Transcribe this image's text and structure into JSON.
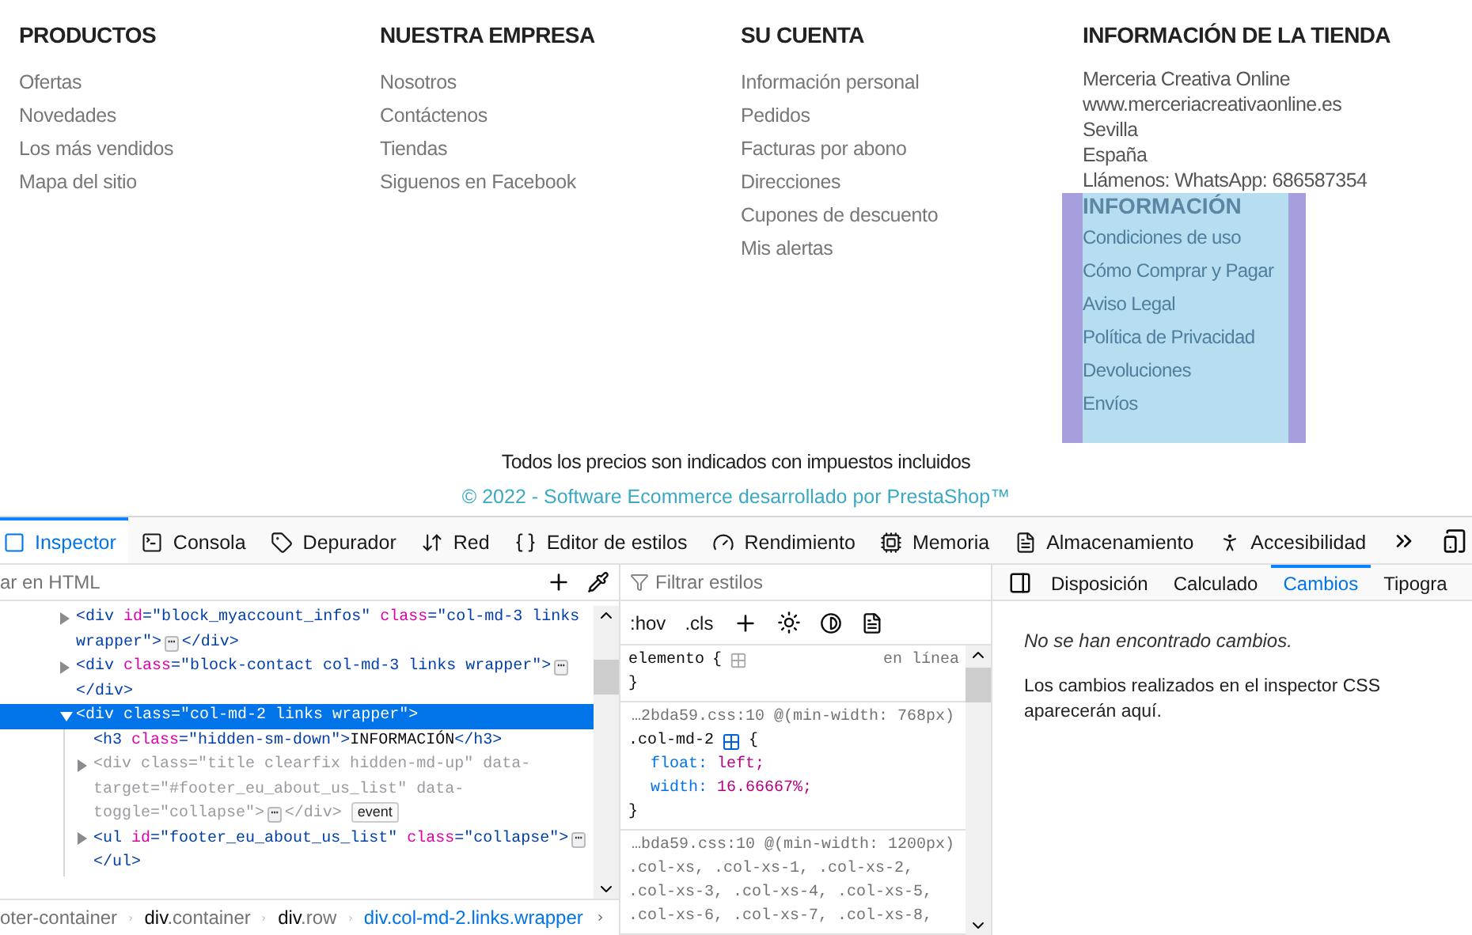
{
  "footer": {
    "columns": [
      {
        "title": "PRODUCTOS",
        "links": [
          "Ofertas",
          "Novedades",
          "Los más vendidos",
          "Mapa del sitio"
        ]
      },
      {
        "title": "NUESTRA EMPRESA",
        "links": [
          "Nosotros",
          "Contáctenos",
          "Tiendas",
          "Siguenos en Facebook"
        ]
      },
      {
        "title": "SU CUENTA",
        "links": [
          "Información personal",
          "Pedidos",
          "Facturas por abono",
          "Direcciones",
          "Cupones de descuento",
          "Mis alertas"
        ]
      }
    ],
    "store_info": {
      "title": "INFORMACIÓN DE LA TIENDA",
      "lines": [
        "Merceria Creativa Online",
        "www.merceriacreativaonline.es",
        "Sevilla",
        "España",
        "Llámenos: WhatsApp: 686587354"
      ]
    },
    "info_block": {
      "title": "INFORMACIÓN",
      "highlighted": true,
      "links": [
        "Condiciones de uso",
        "Cómo Comprar y Pagar",
        "Aviso Legal",
        "Política de Privacidad",
        "Devoluciones",
        "Envíos"
      ]
    },
    "tax_note": "Todos los precios son indicados con impuestos incluidos",
    "copyright": "© 2022 - Software Ecommerce desarrollado por PrestaShop™"
  },
  "devtools": {
    "tabs": [
      {
        "label": "Inspector",
        "selected": true
      },
      {
        "label": "Consola",
        "selected": false
      },
      {
        "label": "Depurador",
        "selected": false
      },
      {
        "label": "Red",
        "selected": false
      },
      {
        "label": "Editor de estilos",
        "selected": false
      },
      {
        "label": "Rendimiento",
        "selected": false
      },
      {
        "label": "Memoria",
        "selected": false
      },
      {
        "label": "Almacenamiento",
        "selected": false
      },
      {
        "label": "Accesibilidad",
        "selected": false
      }
    ],
    "inspector": {
      "search": {
        "placeholder": "ar en HTML"
      },
      "nodes": [
        {
          "kind": "parent",
          "expanded": false,
          "selected": false,
          "hidden": false,
          "lines": [
            [
              {
                "kind": "tag",
                "s": "<div "
              },
              {
                "kind": "attr",
                "s": "id"
              },
              {
                "kind": "tag",
                "s": "=\""
              },
              {
                "kind": "val",
                "s": "block_myaccount_infos"
              },
              {
                "kind": "tag",
                "s": "\" "
              },
              {
                "kind": "attr",
                "s": "class"
              },
              {
                "kind": "tag",
                "s": "=\""
              },
              {
                "kind": "val",
                "s": "col-md-3 links"
              }
            ],
            [
              {
                "kind": "val",
                "s": "wrapper"
              },
              {
                "kind": "tag",
                "s": "\">"
              },
              {
                "kind": "more",
                "s": "⋯"
              },
              {
                "kind": "tag",
                "s": "</div>"
              }
            ]
          ]
        },
        {
          "kind": "parent",
          "expanded": false,
          "selected": false,
          "hidden": false,
          "lines": [
            [
              {
                "kind": "tag",
                "s": "<div "
              },
              {
                "kind": "attr",
                "s": "class"
              },
              {
                "kind": "tag",
                "s": "=\""
              },
              {
                "kind": "val",
                "s": "block-contact col-md-3 links wrapper"
              },
              {
                "kind": "tag",
                "s": "\">"
              },
              {
                "kind": "more",
                "s": "⋯"
              }
            ],
            [
              {
                "kind": "tag",
                "s": "</div>"
              }
            ]
          ]
        },
        {
          "kind": "parent",
          "expanded": true,
          "selected": true,
          "hidden": false,
          "lines": [
            [
              {
                "kind": "tag",
                "s": "<div "
              },
              {
                "kind": "attr",
                "s": "class"
              },
              {
                "kind": "tag",
                "s": "=\""
              },
              {
                "kind": "val",
                "s": "col-md-2 links wrapper"
              },
              {
                "kind": "tag",
                "s": "\">"
              }
            ]
          ],
          "children": [
            {
              "kind": "leaf",
              "selected": false,
              "hidden": false,
              "lines": [
                [
                  {
                    "kind": "tag",
                    "s": "<h3 "
                  },
                  {
                    "kind": "attr",
                    "s": "class"
                  },
                  {
                    "kind": "tag",
                    "s": "=\""
                  },
                  {
                    "kind": "val",
                    "s": "hidden-sm-down"
                  },
                  {
                    "kind": "tag",
                    "s": "\">"
                  },
                  {
                    "kind": "plain",
                    "s": "INFORMACIÓN"
                  },
                  {
                    "kind": "tag",
                    "s": "</h3>"
                  }
                ]
              ]
            },
            {
              "kind": "parent",
              "expanded": false,
              "selected": false,
              "hidden": true,
              "lines": [
                [
                  {
                    "kind": "tag",
                    "s": "<div "
                  },
                  {
                    "kind": "attr",
                    "s": "class"
                  },
                  {
                    "kind": "tag",
                    "s": "=\""
                  },
                  {
                    "kind": "val",
                    "s": "title clearfix hidden-md-up"
                  },
                  {
                    "kind": "tag",
                    "s": "\" "
                  },
                  {
                    "kind": "attr",
                    "s": "data-"
                  }
                ],
                [
                  {
                    "kind": "attr",
                    "s": "target"
                  },
                  {
                    "kind": "tag",
                    "s": "=\""
                  },
                  {
                    "kind": "val",
                    "s": "#footer_eu_about_us_list"
                  },
                  {
                    "kind": "tag",
                    "s": "\" "
                  },
                  {
                    "kind": "attr",
                    "s": "data-"
                  }
                ],
                [
                  {
                    "kind": "attr",
                    "s": "toggle"
                  },
                  {
                    "kind": "tag",
                    "s": "=\""
                  },
                  {
                    "kind": "val",
                    "s": "collapse"
                  },
                  {
                    "kind": "tag",
                    "s": "\">"
                  },
                  {
                    "kind": "more",
                    "s": "⋯"
                  },
                  {
                    "kind": "tag",
                    "s": "</div>"
                  },
                  {
                    "kind": "badge",
                    "s": "event"
                  }
                ]
              ]
            },
            {
              "kind": "parent",
              "expanded": false,
              "selected": false,
              "hidden": false,
              "lines": [
                [
                  {
                    "kind": "tag",
                    "s": "<ul "
                  },
                  {
                    "kind": "attr",
                    "s": "id"
                  },
                  {
                    "kind": "tag",
                    "s": "=\""
                  },
                  {
                    "kind": "val",
                    "s": "footer_eu_about_us_list"
                  },
                  {
                    "kind": "tag",
                    "s": "\" "
                  },
                  {
                    "kind": "attr",
                    "s": "class"
                  },
                  {
                    "kind": "tag",
                    "s": "=\""
                  },
                  {
                    "kind": "val",
                    "s": "collapse"
                  },
                  {
                    "kind": "tag",
                    "s": "\">"
                  },
                  {
                    "kind": "more",
                    "s": "⋯"
                  }
                ],
                [
                  {
                    "kind": "tag",
                    "s": "</ul>"
                  }
                ]
              ]
            }
          ]
        }
      ],
      "breadcrumb": [
        {
          "rest": "oter-container",
          "selected": false
        },
        {
          "tag": "div",
          "rest": ".container",
          "selected": false
        },
        {
          "tag": "div",
          "rest": ".row",
          "selected": false
        },
        {
          "tag": "div",
          "rest": ".col-md-2.links.wrapper",
          "selected": true
        }
      ]
    },
    "rules": {
      "filter": {
        "placeholder": "Filtrar estilos"
      },
      "buttons": [
        ":hov",
        ".cls"
      ],
      "rules": [
        {
          "selector": [
            "elemento"
          ],
          "open": "{",
          "location": "en línea",
          "close": "}"
        },
        {
          "source": "…2bda59.css:10 @(min-width: 768px)",
          "selector": [
            ".col-md-2"
          ],
          "open": "{",
          "declarations": [
            {
              "name": "float:",
              "value": "left;"
            },
            {
              "name": "width:",
              "value": "16.66667%;"
            }
          ],
          "close": "}"
        },
        {
          "source": "…bda59.css:10 @(min-width: 1200px)",
          "selector": [
            ".col-xs, .col-xs-1, .col-xs-2,",
            ".col-xs-3, .col-xs-4, .col-xs-5,",
            ".col-xs-6, .col-xs-7, .col-xs-8,"
          ]
        }
      ]
    },
    "sidebar": {
      "tabs": [
        {
          "label": "Disposición",
          "selected": false
        },
        {
          "label": "Calculado",
          "selected": false
        },
        {
          "label": "Cambios",
          "selected": true
        },
        {
          "label": "Tipogra",
          "selected": false
        }
      ],
      "empty_title": "No se han encontrado cambios.",
      "empty_text": "Los cambios realizados en el inspector CSS aparecerán aquí."
    }
  }
}
